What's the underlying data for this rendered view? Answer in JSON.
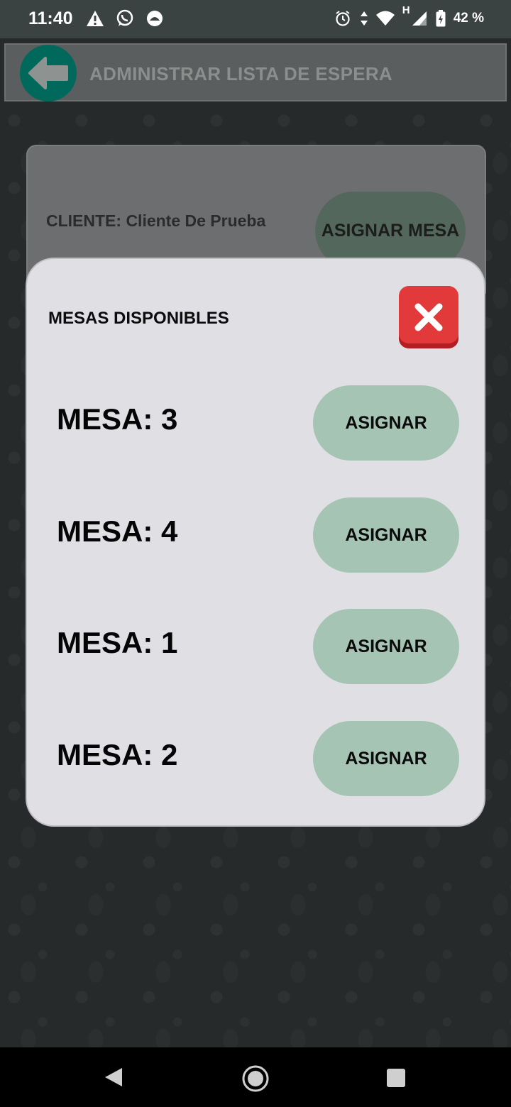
{
  "status_bar": {
    "time": "11:40",
    "battery": "42 %",
    "network_label": "H",
    "left_icons": [
      "warning-icon",
      "whatsapp-icon",
      "app-notification-icon"
    ],
    "right_icons": [
      "alarm-icon",
      "data-arrows-icon",
      "wifi-icon",
      "signal-icon",
      "battery-icon"
    ]
  },
  "app_bar": {
    "title": "ADMINISTRAR LISTA DE ESPERA",
    "accent": "#00695c"
  },
  "client_card": {
    "client_text": "CLIENTE: Cliente De Prueba",
    "assign_button": "ASIGNAR MESA"
  },
  "modal": {
    "title": "MESAS DISPONIBLES",
    "close_color": "#e23a3a",
    "tables": [
      {
        "label": "MESA: 3",
        "button": "ASIGNAR"
      },
      {
        "label": "MESA: 4",
        "button": "ASIGNAR"
      },
      {
        "label": "MESA: 1",
        "button": "ASIGNAR"
      },
      {
        "label": "MESA: 2",
        "button": "ASIGNAR"
      }
    ],
    "button_color": "#a5c4b4"
  },
  "nav_bar": {
    "icons": [
      "back-triangle-icon",
      "home-circle-icon",
      "recents-square-icon"
    ]
  }
}
